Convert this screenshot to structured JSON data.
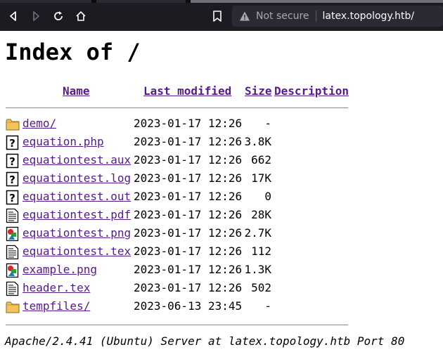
{
  "browser": {
    "security_label": "Not secure",
    "url": "latex.topology.htb/"
  },
  "page": {
    "title": "Index of /",
    "columns": {
      "name": "Name",
      "last_modified": "Last modified",
      "size": "Size",
      "description": "Description"
    },
    "rows": [
      {
        "icon": "folder-icon",
        "name": "demo/",
        "date": "2023-01-17 12:26",
        "size": "-"
      },
      {
        "icon": "unknown-file-icon",
        "name": "equation.php",
        "date": "2023-01-17 12:26",
        "size": "3.8K"
      },
      {
        "icon": "unknown-file-icon",
        "name": "equationtest.aux",
        "date": "2023-01-17 12:26",
        "size": "662"
      },
      {
        "icon": "unknown-file-icon",
        "name": "equationtest.log",
        "date": "2023-01-17 12:26",
        "size": "17K"
      },
      {
        "icon": "unknown-file-icon",
        "name": "equationtest.out",
        "date": "2023-01-17 12:26",
        "size": "0"
      },
      {
        "icon": "text-file-icon",
        "name": "equationtest.pdf",
        "date": "2023-01-17 12:26",
        "size": "28K"
      },
      {
        "icon": "image-file-icon",
        "name": "equationtest.png",
        "date": "2023-01-17 12:26",
        "size": "2.7K"
      },
      {
        "icon": "text-file-icon",
        "name": "equationtest.tex",
        "date": "2023-01-17 12:26",
        "size": "112"
      },
      {
        "icon": "image-file-icon",
        "name": "example.png",
        "date": "2023-01-17 12:26",
        "size": "1.3K"
      },
      {
        "icon": "text-file-icon",
        "name": "header.tex",
        "date": "2023-01-17 12:26",
        "size": "502"
      },
      {
        "icon": "folder-icon",
        "name": "tempfiles/",
        "date": "2023-06-13 23:45",
        "size": "-"
      }
    ],
    "footer": "Apache/2.4.41 (Ubuntu) Server at latex.topology.htb Port 80"
  },
  "colors": {
    "link_visited": "#551a8b",
    "toolbar_bg": "#1c1b22",
    "urlbar_bg": "#2b2a33"
  }
}
